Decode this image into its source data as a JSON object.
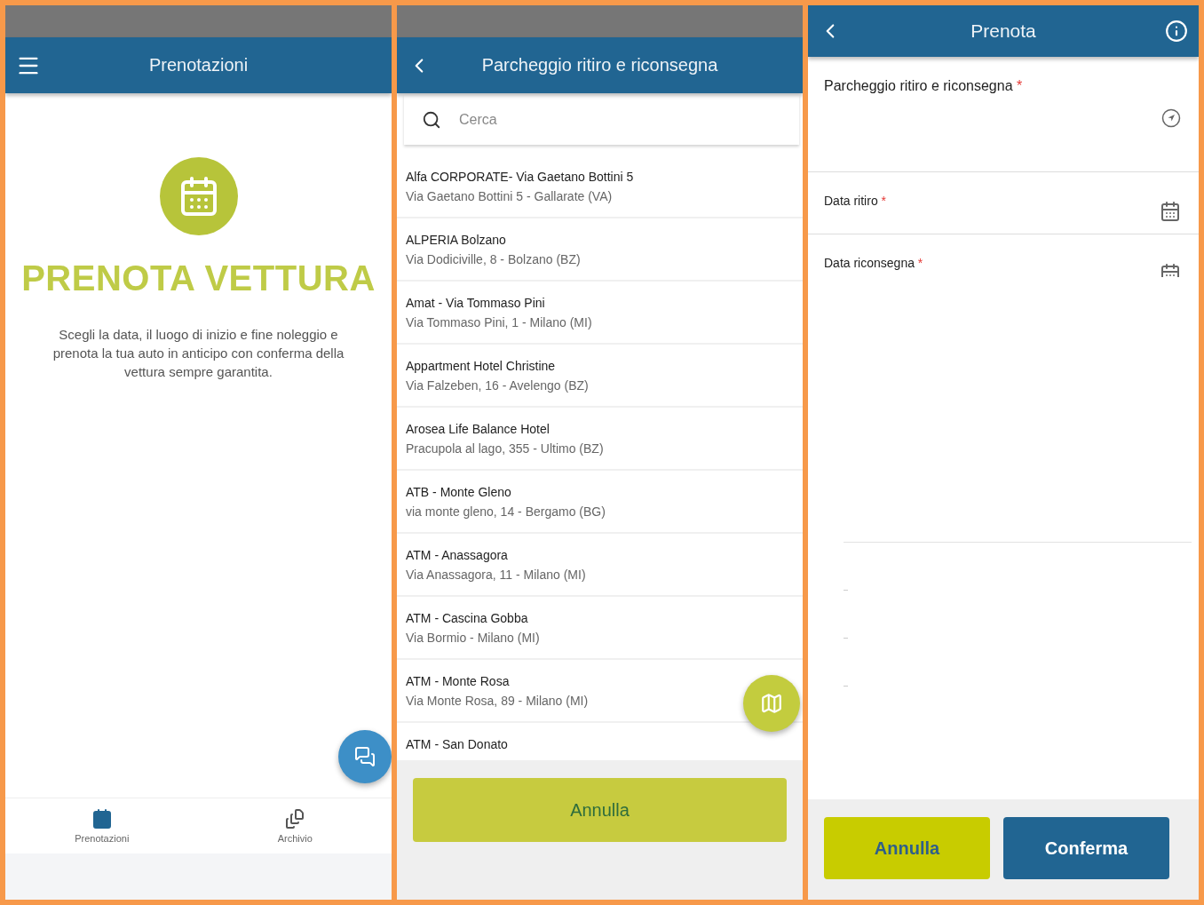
{
  "home": {
    "header": {
      "title": "Prenotazioni"
    },
    "hero": {
      "title": "PRENOTA VETTURA",
      "text": "Scegli la data, il luogo di inizio e fine noleggio e prenota la tua auto in anticipo con conferma della vettura sempre garantita."
    },
    "bottom_nav": [
      {
        "label": "Prenotazioni",
        "selected": true
      },
      {
        "label": "Archivio",
        "selected": false
      }
    ]
  },
  "parking_picker": {
    "header": {
      "title": "Parcheggio ritiro e riconsegna"
    },
    "search": {
      "placeholder": "Cerca"
    },
    "items": [
      {
        "name": "Alfa CORPORATE- Via Gaetano Bottini 5",
        "address": "Via Gaetano Bottini 5 - Gallarate (VA)"
      },
      {
        "name": "ALPERIA Bolzano",
        "address": "Via Dodiciville, 8 - Bolzano (BZ)"
      },
      {
        "name": "Amat - Via Tommaso Pini",
        "address": "Via Tommaso Pini, 1 - Milano (MI)"
      },
      {
        "name": "Appartment Hotel Christine",
        "address": "Via Falzeben, 16 - Avelengo (BZ)"
      },
      {
        "name": "Arosea Life Balance Hotel",
        "address": "Pracupola al lago, 355 - Ultimo (BZ)"
      },
      {
        "name": "ATB - Monte Gleno",
        "address": "via monte gleno, 14 - Bergamo (BG)"
      },
      {
        "name": "ATM - Anassagora",
        "address": "Via Anassagora, 11 - Milano (MI)"
      },
      {
        "name": "ATM - Cascina Gobba",
        "address": "Via Bormio - Milano (MI)"
      },
      {
        "name": "ATM - Monte Rosa",
        "address": "Via Monte Rosa, 89 - Milano (MI)"
      },
      {
        "name": "ATM - San Donato"
      }
    ],
    "cancel_button": "Annulla"
  },
  "booking": {
    "header": {
      "title": "Prenota"
    },
    "fields": [
      {
        "kind": "location",
        "label": "Parcheggio ritiro e riconsegna",
        "required_mark": "*"
      },
      {
        "kind": "date",
        "label": "Data ritiro",
        "required_mark": "*"
      },
      {
        "kind": "date",
        "label": "Data riconsegna",
        "required_mark": "*"
      }
    ],
    "buttons": [
      {
        "kind": "secondary",
        "label": "Annulla"
      },
      {
        "kind": "primary",
        "label": "Conferma"
      }
    ]
  }
}
